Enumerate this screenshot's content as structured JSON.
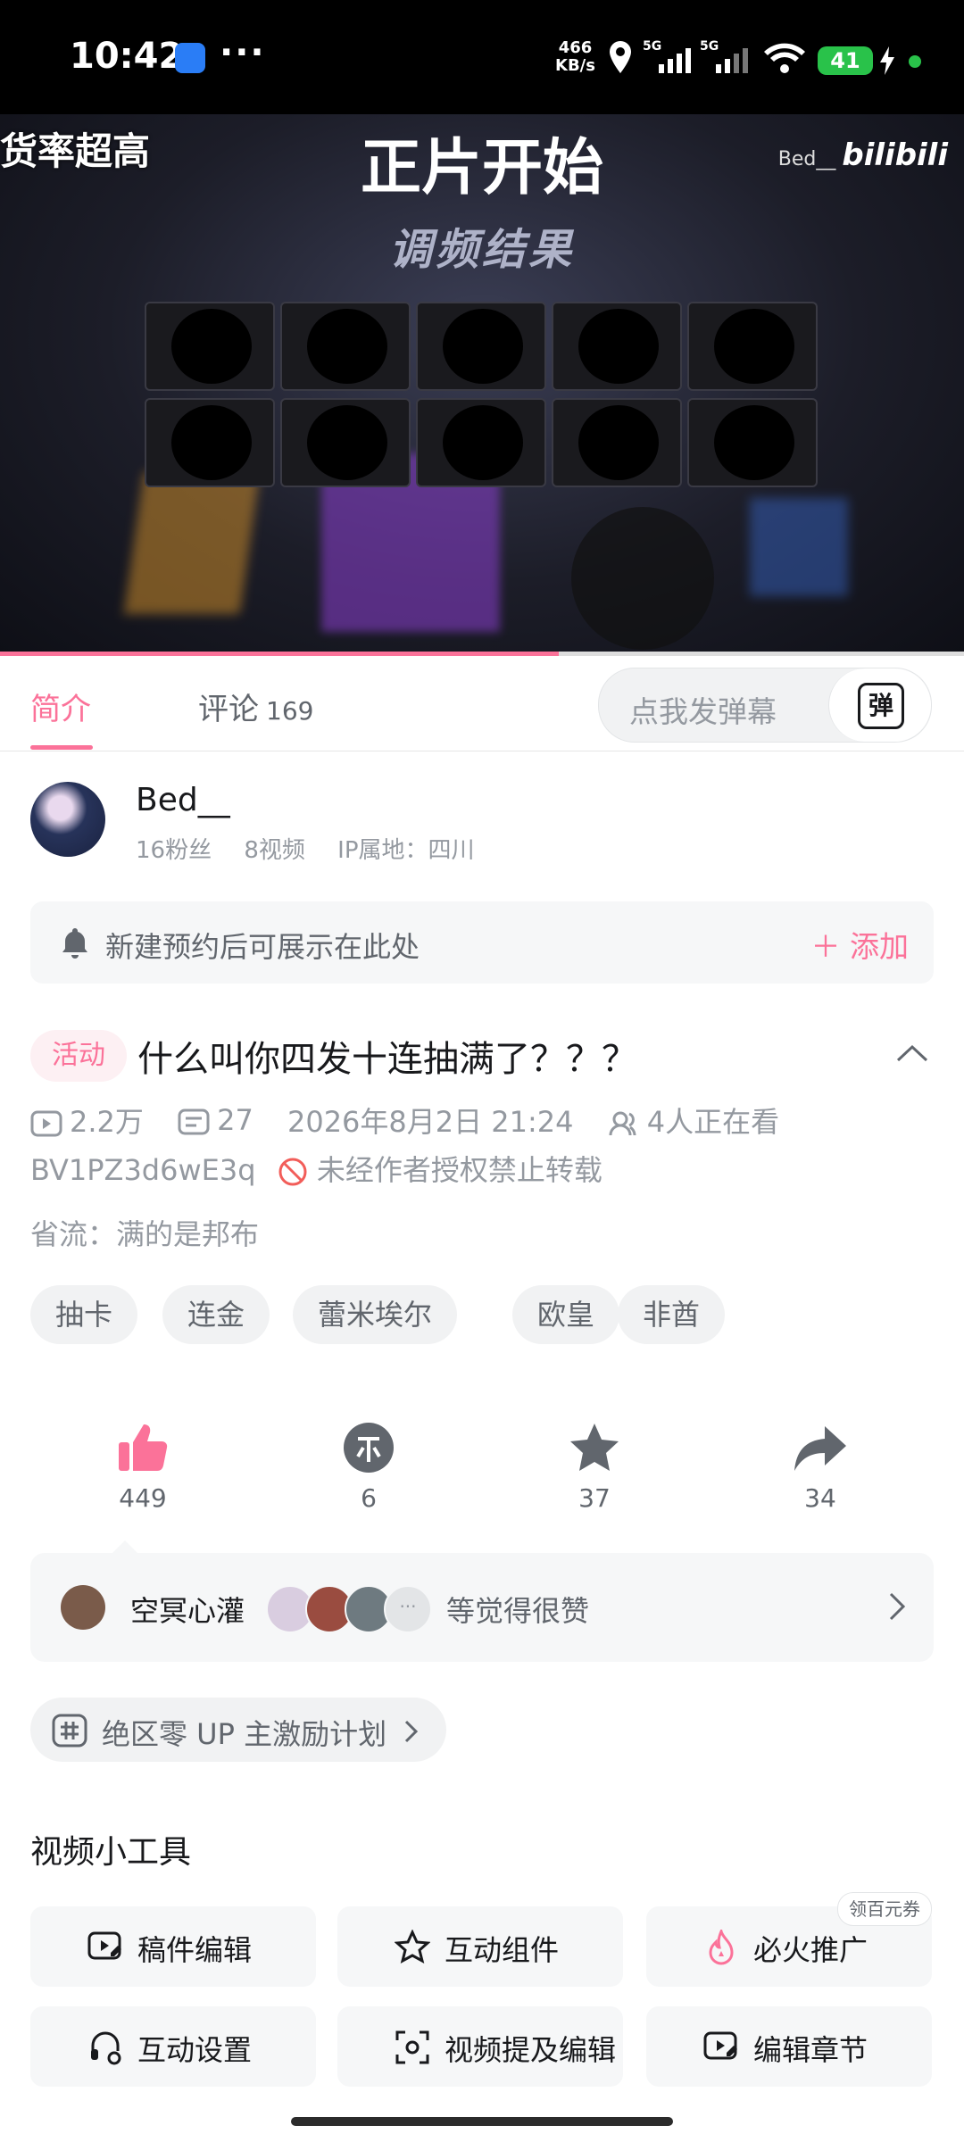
{
  "status_bar": {
    "time": "10:42",
    "more": "···",
    "speed_value": "466",
    "speed_unit": "KB/s",
    "network": "5G",
    "battery": "41"
  },
  "video": {
    "overlay_left": "货率超高",
    "title": "正片开始",
    "subtitle": "调频结果",
    "watermark_user": "Bed__",
    "watermark_brand": "bilibili",
    "progress_fraction": 0.58
  },
  "tabs": {
    "intro": "简介",
    "comments": "评论",
    "comments_count": "169",
    "danmaku_placeholder": "点我发弹幕",
    "danmaku_button": "弹"
  },
  "uploader": {
    "name": "Bed__",
    "fans": "16粉丝",
    "videos": "8视频",
    "ip": "IP属地：四川"
  },
  "reservation": {
    "text": "新建预约后可展示在此处",
    "add": "＋ 添加"
  },
  "video_info": {
    "badge": "活动",
    "title": "什么叫你四发十连抽满了？？？",
    "views": "2.2万",
    "danmaku": "27",
    "date": "2026年8月2日 21:24",
    "watching": "4人正在看",
    "bvid": "BV1PZ3d6wE3q",
    "no_repost": "未经作者授权禁止转载",
    "description": "省流：满的是邦布",
    "tags": [
      "抽卡",
      "连金",
      "蕾米埃尔",
      "欧皇",
      "非酋"
    ]
  },
  "actions": {
    "like": "449",
    "coin": "6",
    "favorite": "37",
    "share": "34"
  },
  "likers": {
    "name": "空冥心灌",
    "text": "等觉得很赞"
  },
  "plan": {
    "text": "绝区零 UP 主激励计划"
  },
  "tools": {
    "title": "视频小工具",
    "coupon": "领百元券",
    "items": [
      "稿件编辑",
      "互动组件",
      "必火推广",
      "互动设置",
      "视频提及编辑",
      "编辑章节"
    ]
  },
  "colors": {
    "accent": "#fb7299",
    "text": "#18191c",
    "secondary": "#9499a0"
  }
}
